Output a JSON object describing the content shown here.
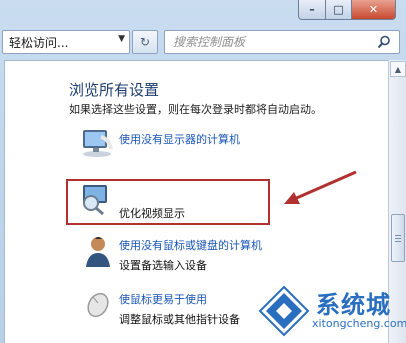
{
  "window": {
    "controls": {
      "minimize": "–",
      "maximize": "□",
      "close": "✕"
    }
  },
  "toolbar": {
    "address_text": "轻松访问...",
    "address_dropdown": "▼",
    "refresh_glyph": "↻",
    "search_placeholder": "搜索控制面板"
  },
  "content": {
    "heading": "浏览所有设置",
    "subtitle": "如果选择这些设置，则在每次登录时都将自动启动。",
    "items": [
      {
        "link": "使用没有显示器的计算机",
        "desc": ""
      },
      {
        "link": "",
        "desc": "优化视频显示"
      },
      {
        "link": "使用没有鼠标或键盘的计算机",
        "desc": "设置备选输入设备"
      },
      {
        "link": "使鼠标更易于使用",
        "desc": "调整鼠标或其他指针设备"
      }
    ]
  },
  "watermark": {
    "title": "系统城",
    "url": "xitongcheng.com"
  },
  "colors": {
    "link": "#1a56b5",
    "heading": "#1e3d6e",
    "highlight_box": "#b23030",
    "watermark": "#2a6fbf"
  }
}
